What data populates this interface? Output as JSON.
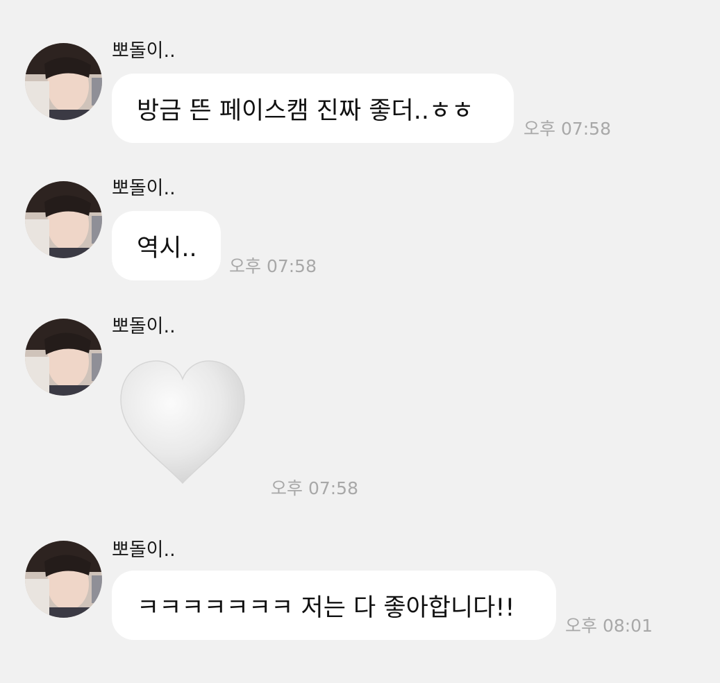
{
  "messages": [
    {
      "sender": "뽀돌이..",
      "text": "방금 뜬 페이스캠 진짜 좋더..ㅎㅎ",
      "time": "오후 07:58"
    },
    {
      "sender": "뽀돌이..",
      "text": "역시..",
      "time": "오후 07:58"
    },
    {
      "sender": "뽀돌이..",
      "emoji": "white-heart-icon",
      "time": "오후 07:58"
    },
    {
      "sender": "뽀돌이..",
      "text": "ㅋㅋㅋㅋㅋㅋㅋ 저는 다 좋아합니다!!",
      "time": "오후 08:01"
    }
  ],
  "colors": {
    "background": "#f1f1f1",
    "bubble": "#ffffff",
    "timestamp": "#a8a8a8",
    "heart": "#e6e6e6"
  }
}
